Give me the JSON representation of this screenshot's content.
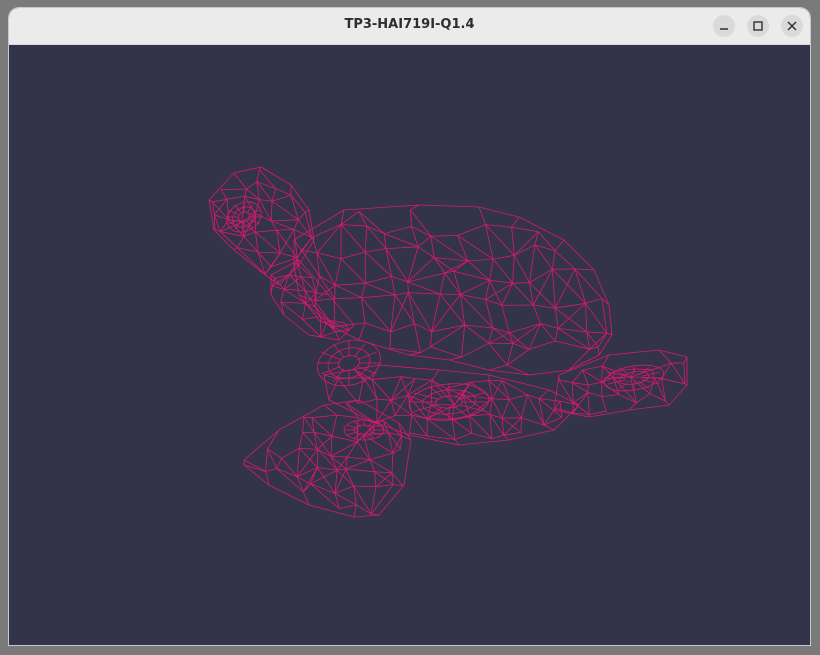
{
  "window": {
    "title": "TP3-HAI719I-Q1.4",
    "buttons": [
      {
        "name": "minimize",
        "icon": "minimize-icon"
      },
      {
        "name": "maximize",
        "icon": "maximize-icon"
      },
      {
        "name": "close",
        "icon": "close-icon"
      }
    ]
  },
  "viewport": {
    "background_color": "#333349",
    "wireframe_color": "#d81b6a",
    "model": "turtle wireframe mesh"
  },
  "colors": {
    "titlebar": "#ebebeb",
    "title_text": "#2e2e2e"
  }
}
